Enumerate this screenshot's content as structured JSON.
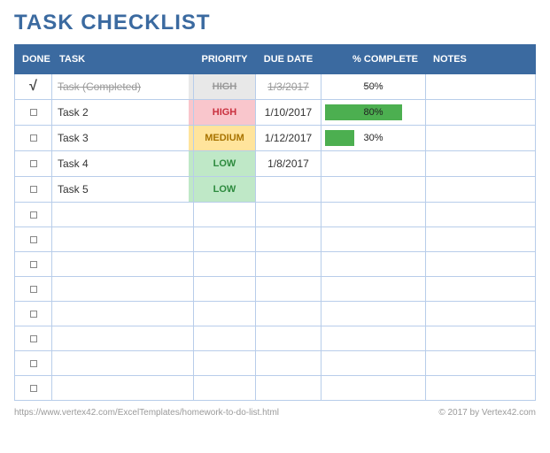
{
  "title": "TASK CHECKLIST",
  "columns": {
    "done": "DONE",
    "task": "TASK",
    "priority": "PRIORITY",
    "due": "DUE DATE",
    "pct": "% COMPLETE",
    "notes": "NOTES"
  },
  "rows": [
    {
      "done": true,
      "task": "Task (Completed)",
      "priority": "HIGH",
      "priority_class": "p-high-done",
      "due": "1/3/2017",
      "pct": 50,
      "pct_label": "50%",
      "bar": false,
      "notes": ""
    },
    {
      "done": false,
      "task": "Task 2",
      "priority": "HIGH",
      "priority_class": "p-high",
      "due": "1/10/2017",
      "pct": 80,
      "pct_label": "80%",
      "bar": true,
      "notes": ""
    },
    {
      "done": false,
      "task": "Task 3",
      "priority": "MEDIUM",
      "priority_class": "p-medium",
      "due": "1/12/2017",
      "pct": 30,
      "pct_label": "30%",
      "bar": true,
      "notes": ""
    },
    {
      "done": false,
      "task": "Task 4",
      "priority": "LOW",
      "priority_class": "p-low",
      "due": "1/8/2017",
      "pct": null,
      "pct_label": "",
      "bar": false,
      "notes": ""
    },
    {
      "done": false,
      "task": "Task 5",
      "priority": "LOW",
      "priority_class": "p-low",
      "due": "",
      "pct": null,
      "pct_label": "",
      "bar": false,
      "notes": ""
    },
    {
      "done": false,
      "task": "",
      "priority": "",
      "priority_class": "",
      "due": "",
      "pct": null,
      "pct_label": "",
      "bar": false,
      "notes": ""
    },
    {
      "done": false,
      "task": "",
      "priority": "",
      "priority_class": "",
      "due": "",
      "pct": null,
      "pct_label": "",
      "bar": false,
      "notes": ""
    },
    {
      "done": false,
      "task": "",
      "priority": "",
      "priority_class": "",
      "due": "",
      "pct": null,
      "pct_label": "",
      "bar": false,
      "notes": ""
    },
    {
      "done": false,
      "task": "",
      "priority": "",
      "priority_class": "",
      "due": "",
      "pct": null,
      "pct_label": "",
      "bar": false,
      "notes": ""
    },
    {
      "done": false,
      "task": "",
      "priority": "",
      "priority_class": "",
      "due": "",
      "pct": null,
      "pct_label": "",
      "bar": false,
      "notes": ""
    },
    {
      "done": false,
      "task": "",
      "priority": "",
      "priority_class": "",
      "due": "",
      "pct": null,
      "pct_label": "",
      "bar": false,
      "notes": ""
    },
    {
      "done": false,
      "task": "",
      "priority": "",
      "priority_class": "",
      "due": "",
      "pct": null,
      "pct_label": "",
      "bar": false,
      "notes": ""
    },
    {
      "done": false,
      "task": "",
      "priority": "",
      "priority_class": "",
      "due": "",
      "pct": null,
      "pct_label": "",
      "bar": false,
      "notes": ""
    }
  ],
  "footer": {
    "url": "https://www.vertex42.com/ExcelTemplates/homework-to-do-list.html",
    "copyright": "© 2017 by Vertex42.com"
  }
}
